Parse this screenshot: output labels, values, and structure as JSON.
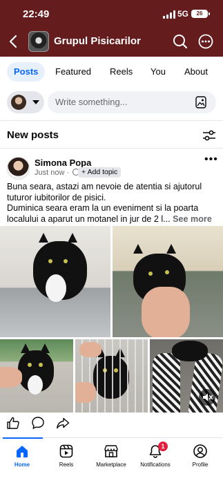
{
  "status_bar": {
    "time": "22:49",
    "network": "5G",
    "battery": "26"
  },
  "header": {
    "title": "Grupul Pisicarilor"
  },
  "tabs": [
    {
      "label": "Posts",
      "active": true
    },
    {
      "label": "Featured",
      "active": false
    },
    {
      "label": "Reels",
      "active": false
    },
    {
      "label": "You",
      "active": false
    },
    {
      "label": "About",
      "active": false
    }
  ],
  "composer": {
    "placeholder": "Write something..."
  },
  "feed": {
    "section_title": "New posts"
  },
  "post": {
    "author": "Simona Popa",
    "time": "Just now",
    "add_topic": "+ Add topic",
    "text_lines": [
      "Buna seara, astazi am nevoie de atentia si ajutorul",
      "tuturor iubitorilor de pisici.",
      "Duminica seara eram la un eveniment si la poarta"
    ],
    "text_last": "localului a aparut un motanel in jur de 2 l...",
    "see_more": "See more"
  },
  "nav": [
    {
      "label": "Home",
      "icon": "home-icon",
      "active": true
    },
    {
      "label": "Reels",
      "icon": "reels-icon",
      "active": false
    },
    {
      "label": "Marketplace",
      "icon": "marketplace-icon",
      "active": false
    },
    {
      "label": "Notifications",
      "icon": "bell-icon",
      "active": false,
      "badge": "1"
    },
    {
      "label": "Profile",
      "icon": "profile-icon",
      "active": false
    }
  ],
  "colors": {
    "header_bg": "#641c1c",
    "accent": "#0866ff",
    "badge": "#e41e3f"
  }
}
